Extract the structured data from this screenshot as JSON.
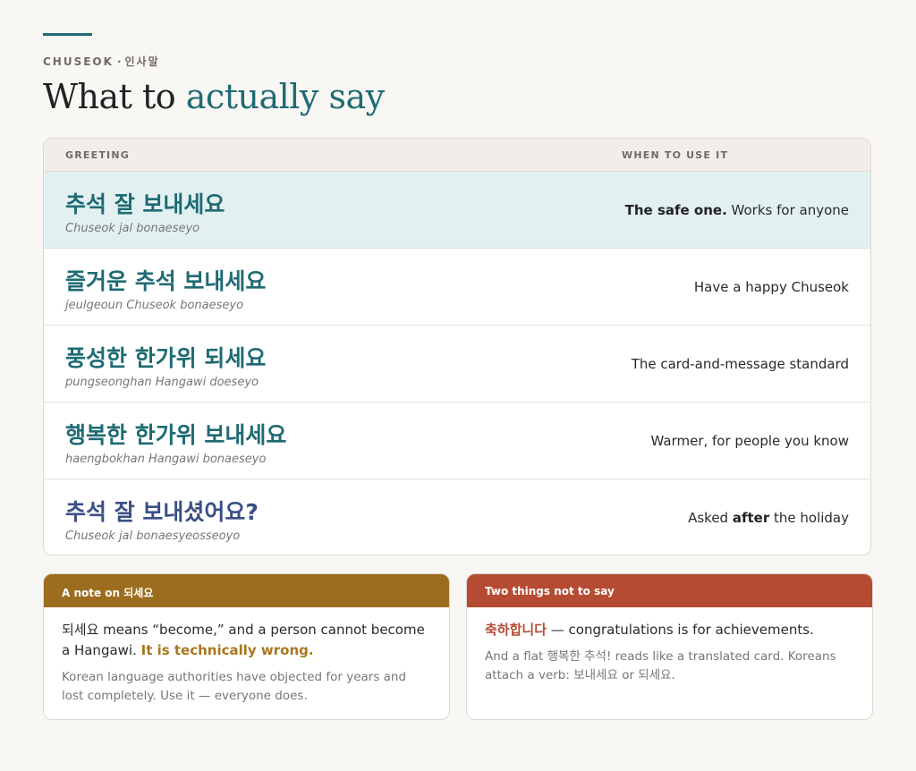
{
  "header": {
    "eyebrow_en": "CHUSEOK",
    "eyebrow_sep": "·",
    "eyebrow_kr": "인사말",
    "title_plain": "What to ",
    "title_accent": "actually say"
  },
  "table": {
    "col_greeting": "GREETING",
    "col_when": "WHEN TO USE IT",
    "rows": [
      {
        "korean": "추석 잘 보내세요",
        "romanization": "Chuseok jal bonaeseyo",
        "use_bold": "The safe one.",
        "use_text": " Works for anyone"
      },
      {
        "korean": "즐거운 추석 보내세요",
        "romanization": "jeulgeoun Chuseok bonaeseyo",
        "use_text": "Have a happy Chuseok"
      },
      {
        "korean": "풍성한 한가위 되세요",
        "romanization": "pungseonghan Hangawi doeseyo",
        "use_text": "The card-and-message standard"
      },
      {
        "korean": "행복한 한가위 보내세요",
        "romanization": "haengbokhan Hangawi bonaeseyo",
        "use_text": "Warmer, for people you know"
      },
      {
        "korean": "추석 잘 보내셨어요?",
        "romanization": "Chuseok jal bonaesyeosseoyo",
        "use_pre": "Asked ",
        "use_bold": "after",
        "use_post": " the holiday"
      }
    ]
  },
  "note_card": {
    "title": "A note on 되세요",
    "main_text": "되세요 means “become,” and a person cannot become a Hangawi. ",
    "main_emph": "It is technically wrong.",
    "sub_text": "Korean language authorities have objected for years and lost completely. Use it — everyone does."
  },
  "avoid_card": {
    "title": "Two things not to say",
    "main_emph": "축하합니다",
    "main_text": " — congratulations is for achievements.",
    "sub_text": "And a flat 행복한 추석! reads like a translated card. Koreans attach a verb: 보내세요 or 되세요."
  },
  "colors": {
    "accent": "#1f6b73",
    "highlight_row": "#e3f0f1",
    "after_row_text": "#3a4f86",
    "note_header": "#9c6d1f",
    "avoid_header": "#b64b33"
  }
}
